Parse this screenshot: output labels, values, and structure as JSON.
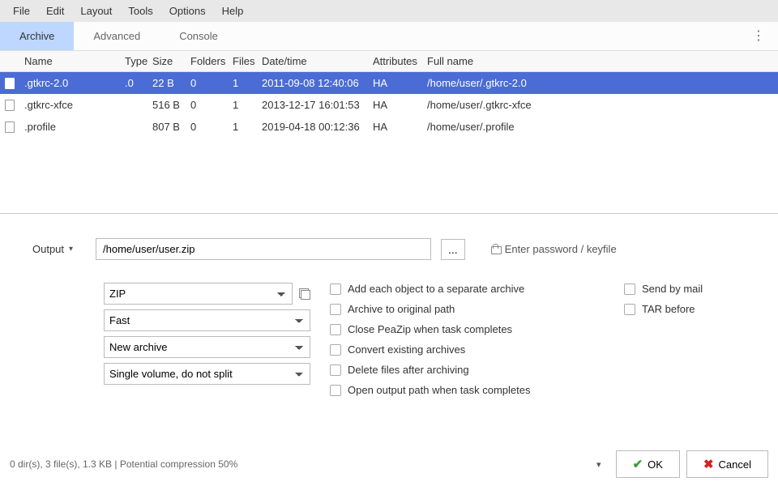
{
  "menubar": [
    "File",
    "Edit",
    "Layout",
    "Tools",
    "Options",
    "Help"
  ],
  "tabs": {
    "items": [
      "Archive",
      "Advanced",
      "Console"
    ],
    "active": 0
  },
  "table": {
    "headers": [
      "Name",
      "Type",
      "Size",
      "Folders",
      "Files",
      "Date/time",
      "Attributes",
      "Full name"
    ],
    "rows": [
      {
        "name": ".gtkrc-2.0",
        "type": ".0",
        "size": "22 B",
        "folders": "0",
        "files": "1",
        "datetime": "2011-09-08 12:40:06",
        "attributes": "HA",
        "fullname": "/home/user/.gtkrc-2.0",
        "selected": true
      },
      {
        "name": ".gtkrc-xfce",
        "type": "",
        "size": "516 B",
        "folders": "0",
        "files": "1",
        "datetime": "2013-12-17 16:01:53",
        "attributes": "HA",
        "fullname": "/home/user/.gtkrc-xfce",
        "selected": false
      },
      {
        "name": ".profile",
        "type": "",
        "size": "807 B",
        "folders": "0",
        "files": "1",
        "datetime": "2019-04-18 00:12:36",
        "attributes": "HA",
        "fullname": "/home/user/.profile",
        "selected": false
      }
    ]
  },
  "output": {
    "label": "Output",
    "path": "/home/user/user.zip",
    "browse": "...",
    "password": "Enter password / keyfile"
  },
  "selects": {
    "format": "ZIP",
    "speed": "Fast",
    "mode": "New archive",
    "split": "Single volume, do not split"
  },
  "checks_main": [
    "Add each object to a separate archive",
    "Archive to original path",
    "Close PeaZip when task completes",
    "Convert existing archives",
    "Delete files after archiving",
    "Open output path when task completes"
  ],
  "checks_right": [
    "Send by mail",
    "TAR before"
  ],
  "footer": {
    "status": "0 dir(s), 3 file(s), 1.3 KB | Potential compression 50%",
    "ok": "OK",
    "cancel": "Cancel"
  }
}
